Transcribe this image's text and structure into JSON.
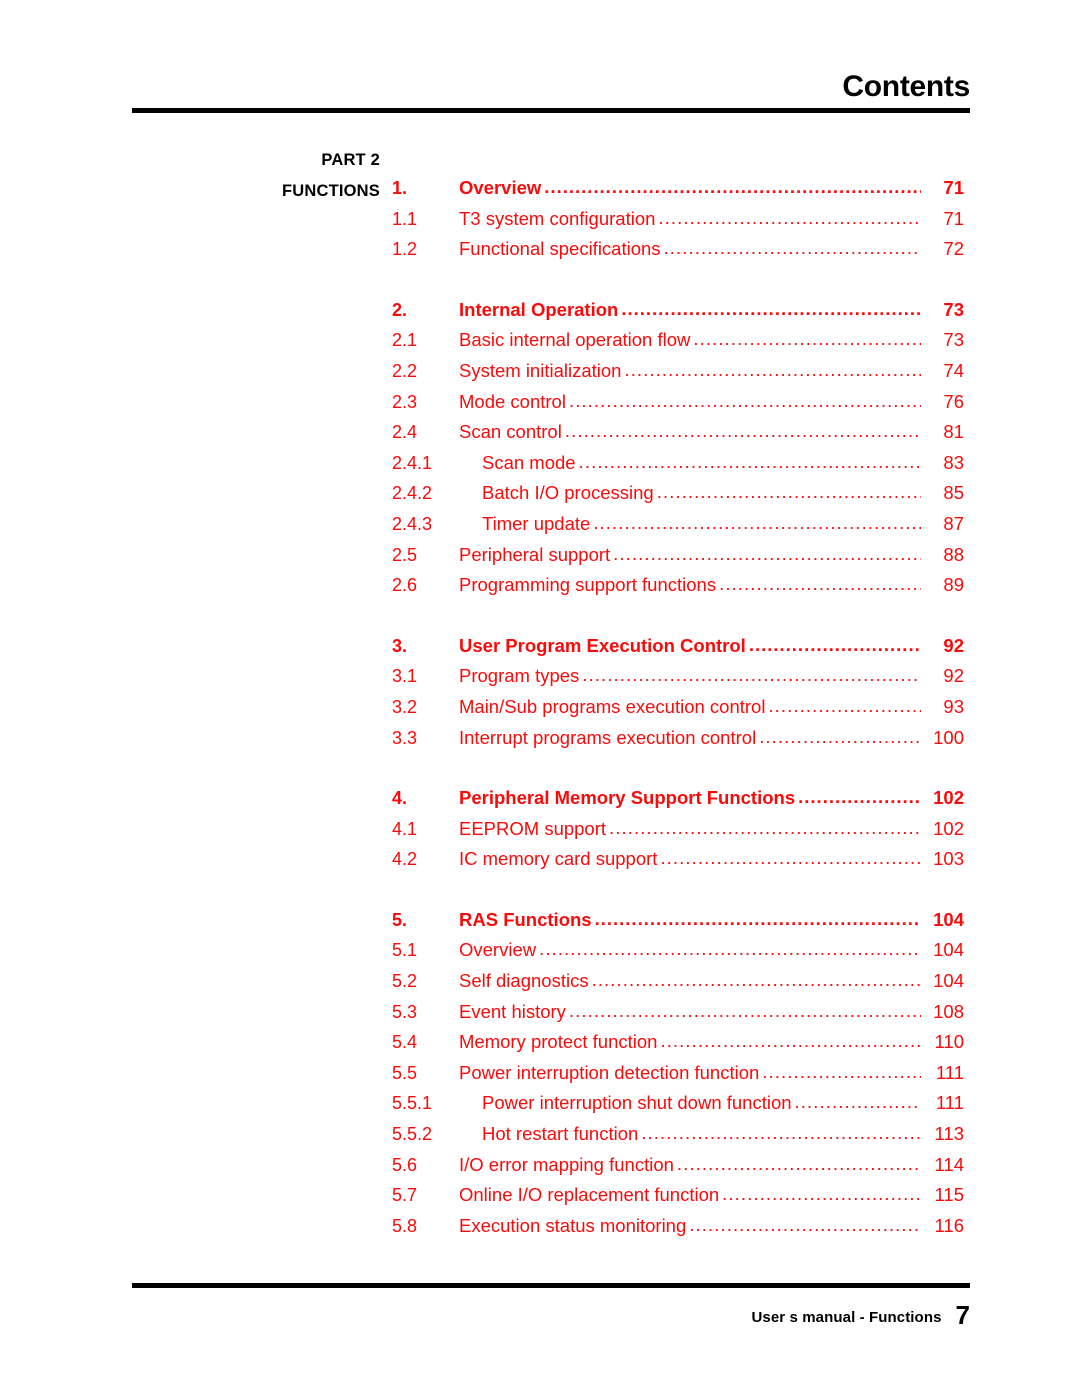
{
  "header": {
    "title": "Contents"
  },
  "part": {
    "line1": "PART 2",
    "line2": "FUNCTIONS"
  },
  "colors": {
    "accent_red": "#FA0A0A",
    "rule_black": "#000000"
  },
  "toc": {
    "groups": [
      {
        "id": "group-1",
        "rows": [
          {
            "level": 1,
            "number": "1.",
            "title": "Overview",
            "page": "71"
          },
          {
            "level": 2,
            "number": "1.1",
            "title": "T3 system configuration",
            "page": "71"
          },
          {
            "level": 2,
            "number": "1.2",
            "title": "Functional specifications",
            "page": "72"
          }
        ]
      },
      {
        "id": "group-2",
        "rows": [
          {
            "level": 1,
            "number": "2.",
            "title": "Internal Operation",
            "page": "73"
          },
          {
            "level": 2,
            "number": "2.1",
            "title": "Basic internal operation flow",
            "page": "73"
          },
          {
            "level": 2,
            "number": "2.2",
            "title": "System initialization",
            "page": "74"
          },
          {
            "level": 2,
            "number": "2.3",
            "title": "Mode control",
            "page": "76"
          },
          {
            "level": 2,
            "number": "2.4",
            "title": "Scan control",
            "page": "81"
          },
          {
            "level": 3,
            "number": "2.4.1",
            "title": "Scan mode",
            "page": "83"
          },
          {
            "level": 3,
            "number": "2.4.2",
            "title": "Batch I/O processing",
            "page": "85"
          },
          {
            "level": 3,
            "number": "2.4.3",
            "title": "Timer update",
            "page": "87"
          },
          {
            "level": 2,
            "number": "2.5",
            "title": "Peripheral support",
            "page": "88"
          },
          {
            "level": 2,
            "number": "2.6",
            "title": "Programming support functions",
            "page": "89"
          }
        ]
      },
      {
        "id": "group-3",
        "rows": [
          {
            "level": 1,
            "number": "3.",
            "title": "User Program Execution Control",
            "page": "92"
          },
          {
            "level": 2,
            "number": "3.1",
            "title": "Program types",
            "page": "92"
          },
          {
            "level": 2,
            "number": "3.2",
            "title": "Main/Sub programs execution control",
            "page": "93"
          },
          {
            "level": 2,
            "number": "3.3",
            "title": "Interrupt programs execution control",
            "page": "100"
          }
        ]
      },
      {
        "id": "group-4",
        "rows": [
          {
            "level": 1,
            "number": "4.",
            "title": "Peripheral Memory Support Functions",
            "page": "102"
          },
          {
            "level": 2,
            "number": "4.1",
            "title": "EEPROM support",
            "page": "102"
          },
          {
            "level": 2,
            "number": "4.2",
            "title": "IC memory card support",
            "page": "103"
          }
        ]
      },
      {
        "id": "group-5",
        "rows": [
          {
            "level": 1,
            "number": "5.",
            "title": "RAS Functions",
            "page": "104"
          },
          {
            "level": 2,
            "number": "5.1",
            "title": "Overview",
            "page": "104"
          },
          {
            "level": 2,
            "number": "5.2",
            "title": "Self diagnostics",
            "page": "104"
          },
          {
            "level": 2,
            "number": "5.3",
            "title": "Event history",
            "page": "108"
          },
          {
            "level": 2,
            "number": "5.4",
            "title": "Memory protect function",
            "page": "110"
          },
          {
            "level": 2,
            "number": "5.5",
            "title": "Power interruption detection function",
            "page": "111"
          },
          {
            "level": 3,
            "number": "5.5.1",
            "title": "Power interruption shut down function",
            "page": "111"
          },
          {
            "level": 3,
            "number": "5.5.2",
            "title": "Hot restart function",
            "page": "113"
          },
          {
            "level": 2,
            "number": "5.6",
            "title": "I/O error mapping function",
            "page": "114"
          },
          {
            "level": 2,
            "number": "5.7",
            "title": "Online I/O replacement function",
            "page": "115"
          },
          {
            "level": 2,
            "number": "5.8",
            "title": "Execution status monitoring",
            "page": "116"
          }
        ]
      }
    ]
  },
  "footer": {
    "label": "User s manual - Functions",
    "page_number": "7"
  }
}
